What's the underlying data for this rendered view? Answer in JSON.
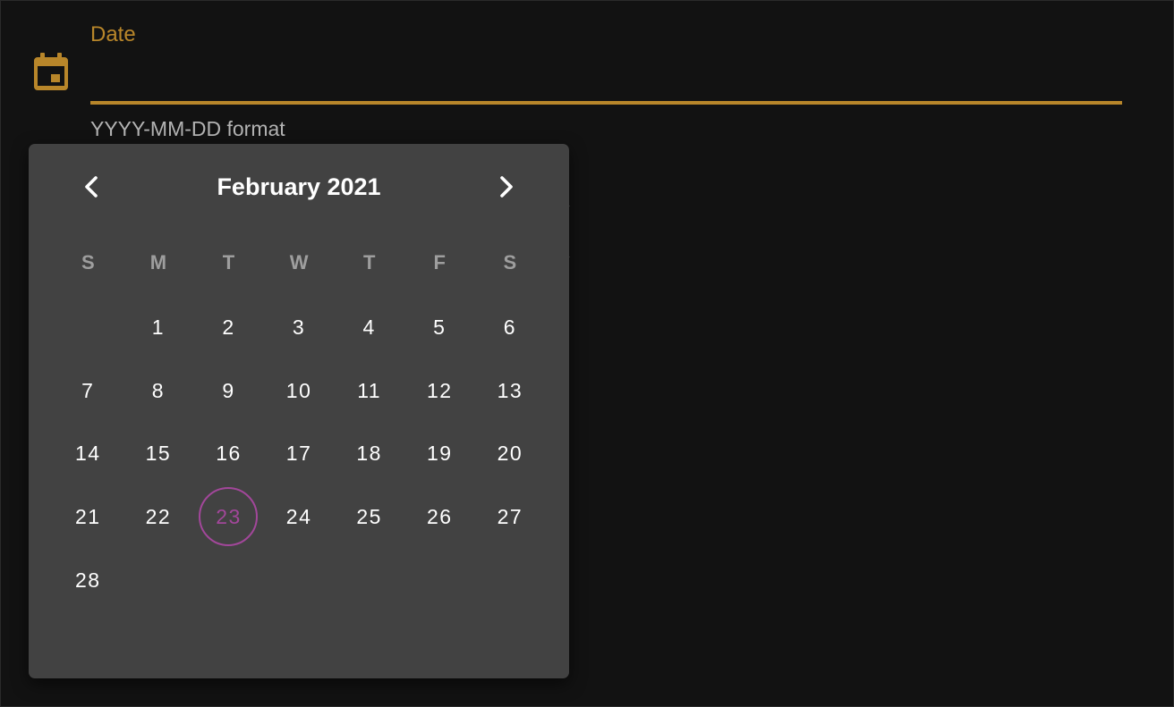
{
  "field": {
    "label": "Date",
    "value": "",
    "placeholder": "",
    "hint": "YYYY-MM-DD format",
    "icon": "calendar-icon",
    "accent_color": "#b8862a"
  },
  "calendar": {
    "month_title": "February 2021",
    "prev_icon": "chevron-left-icon",
    "next_icon": "chevron-right-icon",
    "weekdays": [
      "S",
      "M",
      "T",
      "W",
      "T",
      "F",
      "S"
    ],
    "weeks": [
      [
        "",
        "1",
        "2",
        "3",
        "4",
        "5",
        "6"
      ],
      [
        "7",
        "8",
        "9",
        "10",
        "11",
        "12",
        "13"
      ],
      [
        "14",
        "15",
        "16",
        "17",
        "18",
        "19",
        "20"
      ],
      [
        "21",
        "22",
        "23",
        "24",
        "25",
        "26",
        "27"
      ],
      [
        "28",
        "",
        "",
        "",
        "",
        "",
        ""
      ]
    ],
    "today": "23",
    "today_color": "#a2479a",
    "background_color": "#424242"
  }
}
